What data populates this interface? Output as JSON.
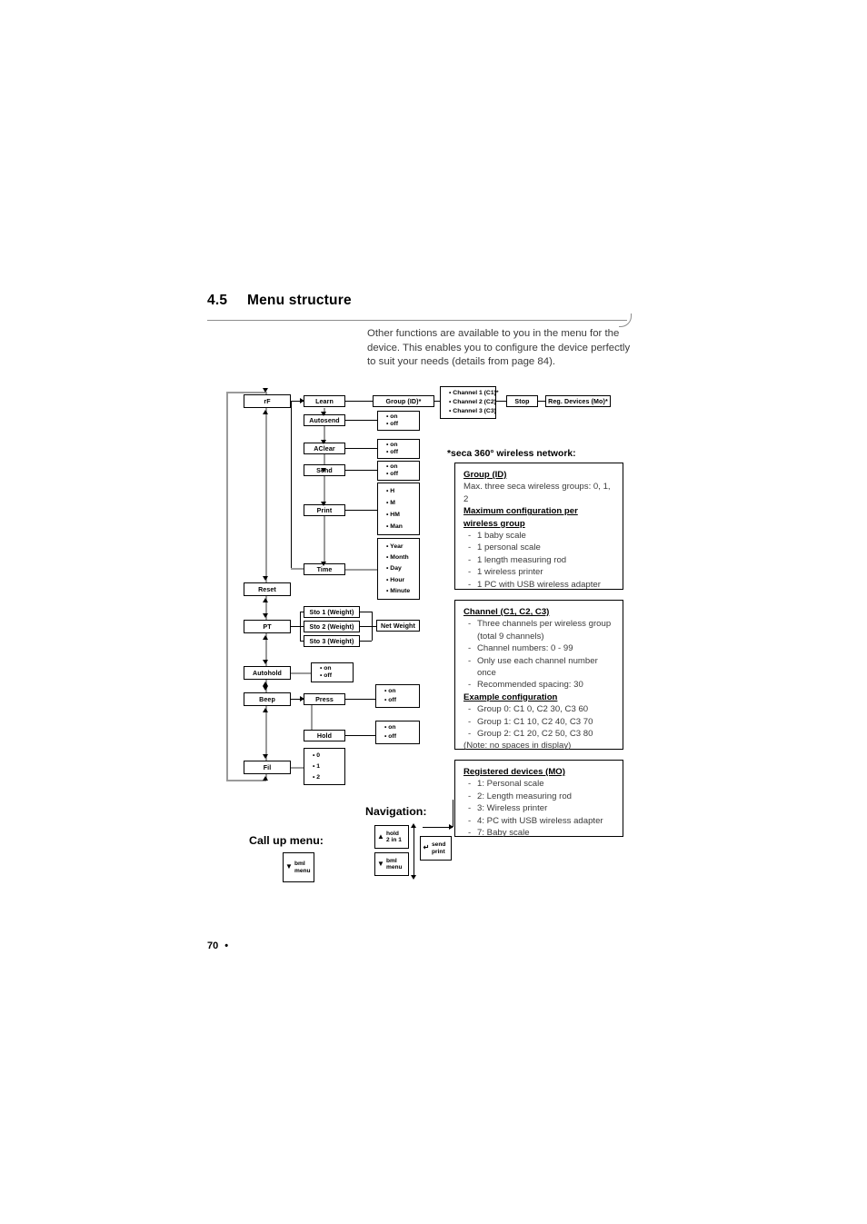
{
  "heading": {
    "number": "4.5",
    "title": "Menu structure"
  },
  "intro": "Other functions are available to you in the menu for the device. This enables you to configure the device perfectly to suit your needs (details from page 84).",
  "footer": {
    "page_number": "70",
    "bullet": "•"
  },
  "flowchart": {
    "main_column": [
      {
        "label": "rF"
      },
      {
        "label": "Reset"
      },
      {
        "label": "PT"
      },
      {
        "label": "Autohold"
      },
      {
        "label": "Beep"
      },
      {
        "label": "Fil"
      }
    ],
    "rf_submenu": [
      {
        "label": "Learn"
      },
      {
        "label": "Autosend"
      },
      {
        "label": "AClear"
      },
      {
        "label": "Send"
      },
      {
        "label": "Print"
      },
      {
        "label": "Time"
      }
    ],
    "group_id": "Group (ID)*",
    "channels": [
      "Channel 1 (C1)*",
      "Channel 2 (C2)",
      "Channel 3 (C3)"
    ],
    "stop": "Stop",
    "reg_devices": "Reg. Devices (Mo)*",
    "autosend_values": [
      "on",
      "off"
    ],
    "aclear_values": [
      "on",
      "off"
    ],
    "send_values": [
      "on",
      "off"
    ],
    "print_values": [
      "H",
      "M",
      "HM",
      "Man"
    ],
    "time_values": [
      "Year",
      "Month",
      "Day",
      "Hour",
      "Minute"
    ],
    "pt_stores": [
      "Sto 1 (Weight)",
      "Sto 2 (Weight)",
      "Sto 3 (Weight)"
    ],
    "net_weight": "Net Weight",
    "autohold_values": [
      "on",
      "off"
    ],
    "beep_submenu": [
      {
        "label": "Press"
      },
      {
        "label": "Hold"
      }
    ],
    "press_values": [
      "on",
      "off"
    ],
    "hold_values": [
      "on",
      "off"
    ],
    "fil_values": [
      "0",
      "1",
      "2"
    ]
  },
  "side_notes": {
    "title": "*seca 360° wireless network:",
    "group_box": {
      "heading": "Group (ID)",
      "text": "Max. three seca wireless groups: 0, 1, 2",
      "heading2_line1": "Maximum configuration per ",
      "heading2_line2": "wireless group",
      "items": [
        "1 baby scale",
        "1 personal scale",
        "1 length measuring rod",
        "1 wireless printer",
        "1 PC with USB wireless adapter"
      ]
    },
    "channel_box": {
      "heading": "Channel (C1, C2, C3)",
      "items": [
        "Three channels per wireless group (total 9 channels)",
        "Channel numbers: 0 - 99",
        "Only use each channel number once",
        "Recommended spacing: 30"
      ],
      "heading2": "Example configuration",
      "examples": [
        "Group 0: C1 0, C2 30, C3 60",
        "Group 1: C1 10, C2 40, C3 70",
        "Group 2: C1 20, C2 50, C3 80"
      ],
      "note": "(Note: no spaces in display)"
    },
    "registered_box": {
      "heading": "Registered devices (MO)",
      "items": [
        "1: Personal scale",
        "2: Length measuring rod",
        "3: Wireless printer",
        "4: PC with USB wireless adapter",
        "7: Baby scale"
      ]
    }
  },
  "navigation": {
    "nav_title": "Navigation:",
    "callup_title": "Call up menu:",
    "keys": {
      "callup": {
        "glyph": "▼",
        "line1": "bmI",
        "line2": "menu"
      },
      "up": {
        "glyph": "▲",
        "line1": "hold",
        "line2": "2 in 1"
      },
      "down": {
        "glyph": "▼",
        "line1": "bmI",
        "line2": "menu"
      },
      "enter": {
        "glyph": "↵",
        "line1": "send",
        "line2": "print"
      }
    }
  }
}
